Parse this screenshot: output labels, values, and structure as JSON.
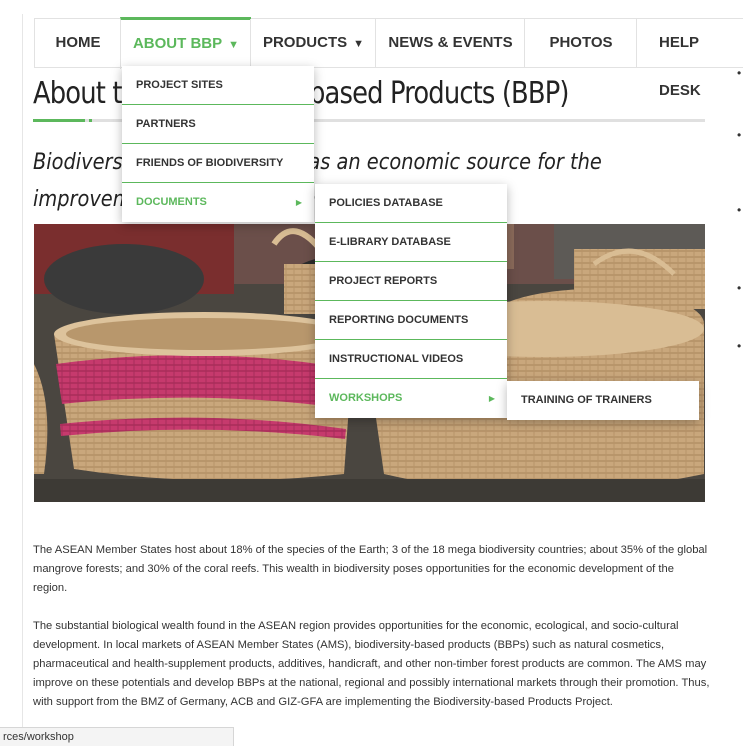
{
  "nav": {
    "items": [
      {
        "label": "HOME"
      },
      {
        "label": "ABOUT BBP",
        "caret": "▼"
      },
      {
        "label": "PRODUCTS",
        "caret": "▼"
      },
      {
        "label": "NEWS & EVENTS"
      },
      {
        "label": "PHOTOS"
      },
      {
        "label": "HELP DESK"
      }
    ],
    "active_color": "#5cb85c"
  },
  "page": {
    "title": "About the Biodiversity-based Products (BBP)",
    "subtitle": "Biodiversity-based Products as an economic source for the improvement of livelihoods and biodiversity",
    "paragraphs": [
      "The ASEAN Member States host about 18% of the species of the Earth; 3 of the 18 mega biodiversity countries; about 35% of the global mangrove forests; and 30% of the coral reefs. This wealth in biodiversity poses opportunities for the economic development of the region.",
      "The substantial biological wealth found in the ASEAN region provides opportunities for the economic, ecological, and socio-cultural development. In local markets of ASEAN Member States (AMS), biodiversity-based products (BBPs) such as natural cosmetics, pharmaceutical and health-supplement products, additives, handicraft, and other non-timber forest products are common. The AMS may improve on these potentials and develop BBPs at the national, regional and possibly international markets through their promotion.  Thus, with support from the BMZ of Germany, ACB and GIZ-GFA are implementing the Biodiversity-based Products Project."
    ],
    "bullets": [
      "•",
      "•",
      "•",
      "•",
      "•"
    ]
  },
  "menus": {
    "about": [
      {
        "label": "PROJECT SITES"
      },
      {
        "label": "PARTNERS"
      },
      {
        "label": "FRIENDS OF BIODIVERSITY"
      },
      {
        "label": "DOCUMENTS",
        "arrow": "▶"
      }
    ],
    "documents": [
      {
        "label": "POLICIES DATABASE"
      },
      {
        "label": "E-LIBRARY DATABASE"
      },
      {
        "label": "PROJECT REPORTS"
      },
      {
        "label": "REPORTING DOCUMENTS"
      },
      {
        "label": "INSTRUCTIONAL VIDEOS"
      },
      {
        "label": "WORKSHOPS",
        "arrow": "▶"
      }
    ],
    "workshops": [
      {
        "label": "TRAINING OF TRAINERS"
      }
    ]
  },
  "statusbar": {
    "text": "rces/workshop"
  }
}
